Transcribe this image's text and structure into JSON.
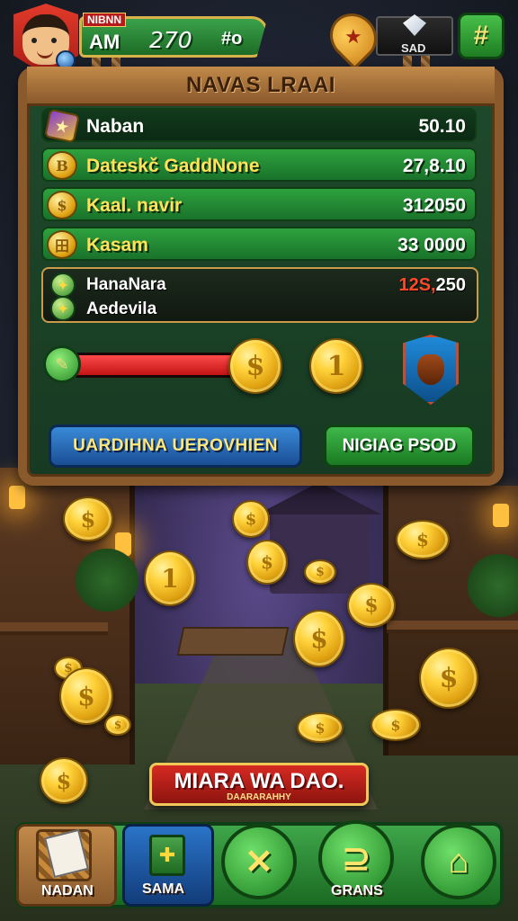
{
  "header": {
    "player_tag": "NIBNN",
    "resource_label": "AM",
    "resource_value": "270",
    "resource_extra": "#o",
    "gem_label": "SAD",
    "star_icon": "star-icon",
    "plus_label": "#"
  },
  "panel": {
    "title": "NAVAS LRAAI",
    "rows": [
      {
        "icon": "star-badge-icon",
        "glyph": "★",
        "label": "Naban",
        "value": "50.10"
      },
      {
        "icon": "coin-icon",
        "glyph": "B",
        "label": "Dateskč GaddNone",
        "value": "27,8.10"
      },
      {
        "icon": "coin-icon",
        "glyph": "$",
        "label": "Kaal. navir",
        "value": "312050"
      },
      {
        "icon": "coin-icon",
        "glyph": "田",
        "label": "Kasam",
        "value": "33 0000"
      }
    ],
    "special_row": {
      "line1": "HanaNara",
      "line2": "Aedevila",
      "value_red": "12S,",
      "value_white": "250"
    },
    "progress": {
      "fraction": 0.96,
      "icon": "paintbrush-icon"
    },
    "coin_buttons": [
      {
        "glyph": "$"
      },
      {
        "glyph": "1"
      }
    ],
    "shield_icon": "shield-helmet-icon",
    "primary_button": "UARDIHNA UEROVHIEN",
    "secondary_button": "NIGIAG PSOD"
  },
  "banner": {
    "title": "MIARA WA DAO.",
    "subtitle": "DAARARAHHY"
  },
  "nav": {
    "items": [
      {
        "label": "NADAN",
        "icon": "basket-icon"
      },
      {
        "label": "SAMA",
        "icon": "map-icon"
      },
      {
        "label": "",
        "icon": "crossed-tools-icon",
        "glyph": "✕"
      },
      {
        "label": "GRANS",
        "icon": "padlock-icon",
        "glyph": "⊇"
      },
      {
        "label": "",
        "icon": "home-icon",
        "glyph": "⌂"
      }
    ]
  },
  "colors": {
    "panel_green": "#1f4a2c",
    "wood": "#8a5a2c",
    "gold": "#ffd23a",
    "red_bar": "#e02a2a",
    "blue_button": "#2a6ab8",
    "green_button": "#2a9a36"
  }
}
